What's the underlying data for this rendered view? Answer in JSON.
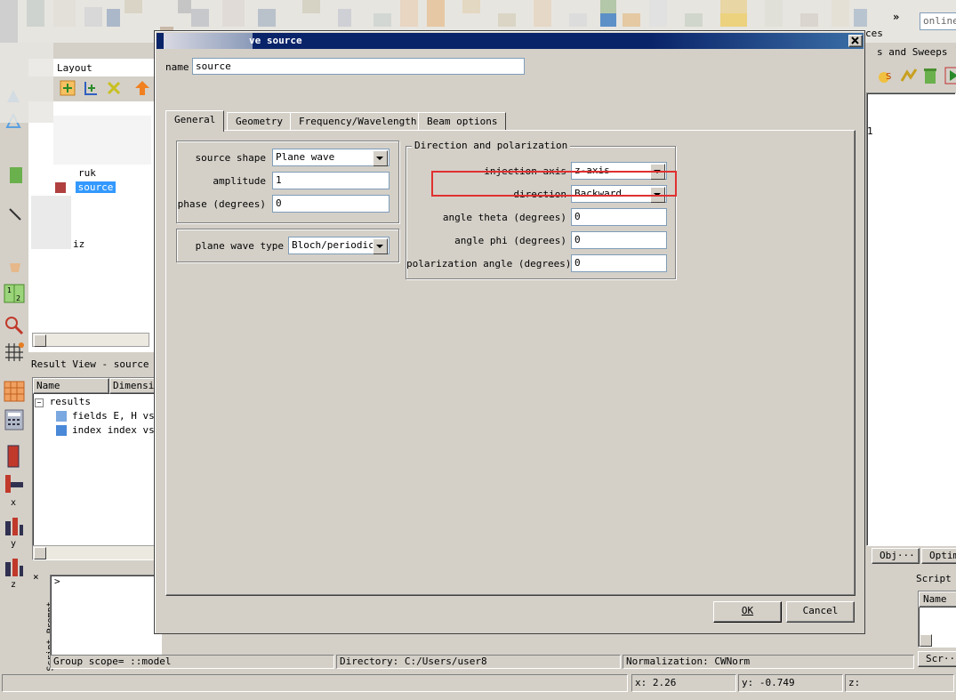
{
  "dialog": {
    "title": "ve source",
    "name_label": "name",
    "name_value": "source",
    "tabs": [
      "General",
      "Geometry",
      "Frequency/Wavelength",
      "Beam options"
    ],
    "left_panel": {
      "source_shape_label": "source shape",
      "source_shape_value": "Plane wave",
      "amplitude_label": "amplitude",
      "amplitude_value": "1",
      "phase_label": "phase (degrees)",
      "phase_value": "0",
      "plane_wave_type_label": "plane wave type",
      "plane_wave_type_value": "Bloch/periodic"
    },
    "direction_group": {
      "title": "Direction and polarization",
      "injection_axis_label": "injection axis",
      "injection_axis_value": "z-axis",
      "direction_label": "direction",
      "direction_value": "Backward",
      "angle_theta_label": "angle theta (degrees)",
      "angle_theta_value": "0",
      "angle_phi_label": "angle phi (degrees)",
      "angle_phi_value": "0",
      "polarization_label": "polarization angle (degrees)",
      "polarization_value": "0"
    },
    "ok_label": "OK",
    "cancel_label": "Cancel",
    "highlight_color": "#e03030"
  },
  "background": {
    "top_right_search": "online",
    "top_right_more": "»",
    "top_right_tab_fragment": "ces",
    "sweeps_fragment": "s and Sweeps",
    "layout_label": "Layout",
    "tree": {
      "item_partial": "ruk",
      "item_selected": "source",
      "item_z": "iz"
    },
    "right_number": "1",
    "result_view": {
      "title": "Result View - source",
      "col_name": "Name",
      "col_dimension": "Dimensio",
      "root": "results",
      "rows": [
        {
          "name": "fields",
          "desc": "E, H vs :"
        },
        {
          "name": "index",
          "desc": "index vs"
        }
      ]
    },
    "right_tabs": [
      "Obj···",
      "Optim"
    ],
    "script_workspace_title": "Script W",
    "script_name_col": "Name",
    "script_button": "Scr···",
    "script_prompt_label": "Script Prompt",
    "prompt_symbol": ">",
    "axis_x": "x",
    "axis_y": "y",
    "axis_z": "z",
    "status": {
      "group_scope": "Group scope= ::model",
      "directory": "Directory: C:/Users/user8",
      "normalization": "Normalization: CWNorm"
    },
    "coords": {
      "x_label": "x:",
      "x_value": "2.26",
      "y_label": "y:",
      "y_value": "-0.749",
      "z_label": "z:",
      "z_value": ""
    }
  }
}
